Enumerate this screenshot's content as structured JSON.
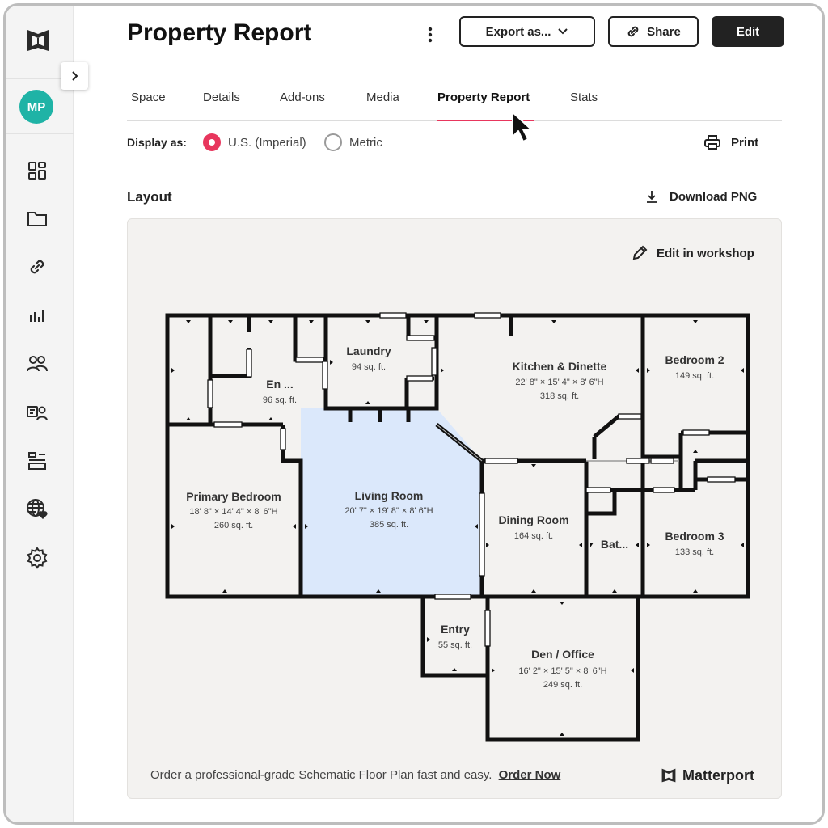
{
  "header": {
    "title": "Property Report",
    "export_label": "Export as...",
    "share_label": "Share",
    "edit_label": "Edit"
  },
  "sidebar": {
    "avatar_initials": "MP",
    "avatar_color": "#1fb3a6",
    "items": [
      {
        "icon": "dashboard-icon"
      },
      {
        "icon": "folder-icon"
      },
      {
        "icon": "link-icon"
      },
      {
        "icon": "analytics-icon"
      },
      {
        "icon": "users-icon"
      },
      {
        "icon": "user-access-icon"
      },
      {
        "icon": "layout-icon"
      },
      {
        "icon": "globe-heart-icon"
      },
      {
        "icon": "settings-icon"
      }
    ]
  },
  "tabs": [
    {
      "label": "Space"
    },
    {
      "label": "Details"
    },
    {
      "label": "Add-ons"
    },
    {
      "label": "Media"
    },
    {
      "label": "Property Report",
      "active": true
    },
    {
      "label": "Stats"
    }
  ],
  "display": {
    "label": "Display as:",
    "options": [
      {
        "label": "U.S. (Imperial)",
        "selected": true
      },
      {
        "label": "Metric",
        "selected": false
      }
    ],
    "print_label": "Print"
  },
  "layout": {
    "title": "Layout",
    "download_label": "Download PNG",
    "edit_workshop_label": "Edit in workshop",
    "rooms": [
      {
        "name": "En ...",
        "area": "96 sq. ft."
      },
      {
        "name": "Laundry",
        "area": "94 sq. ft."
      },
      {
        "name": "Kitchen & Dinette",
        "dims": "22' 8\" × 15' 4\" × 8' 6\"H",
        "area": "318 sq. ft."
      },
      {
        "name": "Bedroom 2",
        "area": "149 sq. ft."
      },
      {
        "name": "Primary Bedroom",
        "dims": "18' 8\" × 14' 4\" × 8' 6\"H",
        "area": "260 sq. ft."
      },
      {
        "name": "Living Room",
        "dims": "20' 7\" × 19' 8\" × 8' 6\"H",
        "area": "385 sq. ft."
      },
      {
        "name": "Dining Room",
        "area": "164 sq. ft."
      },
      {
        "name": "Bat...",
        "area": ""
      },
      {
        "name": "Bedroom 3",
        "area": "133 sq. ft."
      },
      {
        "name": "Entry",
        "area": "55 sq. ft."
      },
      {
        "name": "Den / Office",
        "dims": "16' 2\" × 15' 5\" × 8' 6\"H",
        "area": "249 sq. ft."
      }
    ],
    "highlight_color": "#dbe8fb",
    "order_text": "Order a professional-grade Schematic Floor Plan fast and easy.",
    "order_link": "Order Now",
    "brand_name": "Matterport"
  },
  "colors": {
    "accent": "#e8365d",
    "dark_button": "#222222"
  }
}
